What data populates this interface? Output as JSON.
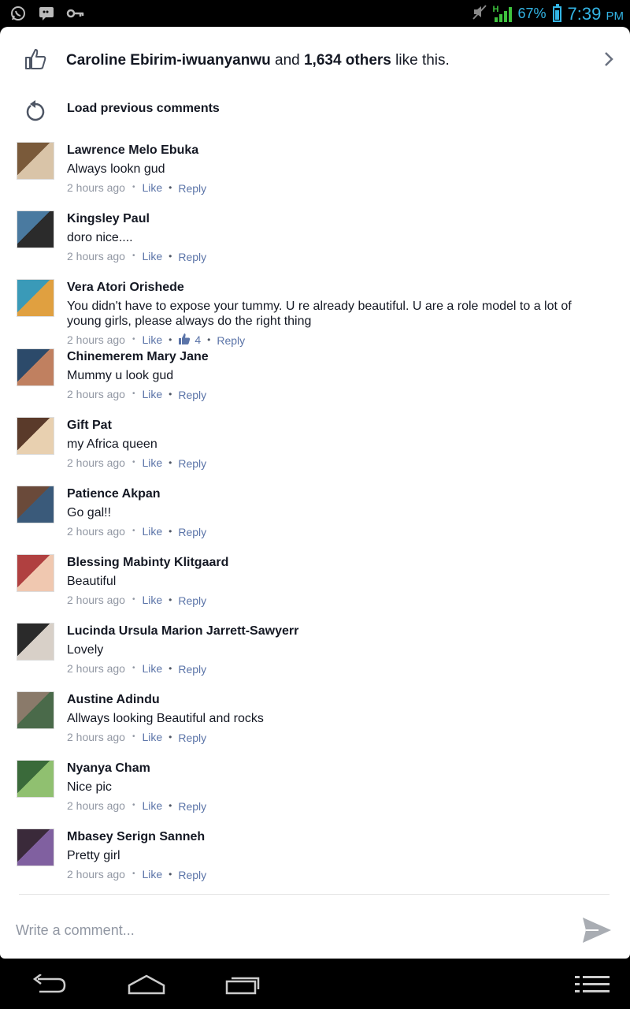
{
  "status_bar": {
    "battery_pct": "67%",
    "time": "7:39",
    "ampm": "PM",
    "network": "H",
    "icons": [
      "whatsapp-icon",
      "bbm-icon",
      "key-icon",
      "mute-icon",
      "signal-icon",
      "battery-icon"
    ]
  },
  "likes": {
    "first_liker": "Caroline Ebirim-iwuanyanwu",
    "connector": "and",
    "others": "1,634 others",
    "suffix": "like this."
  },
  "load_previous": "Load previous comments",
  "comments": [
    {
      "author": "Lawrence Melo Ebuka",
      "text": "Always lookn gud",
      "time": "2 hours ago",
      "like": "Like",
      "reply": "Reply"
    },
    {
      "author": "Kingsley Paul",
      "text": "doro nice....",
      "time": "2 hours ago",
      "like": "Like",
      "reply": "Reply"
    },
    {
      "author": "Vera Atori Orishede",
      "text": "You didn't have to expose your tummy. U re already beautiful. U are a role model to a lot of young girls, please always do the right thing",
      "time": "2 hours ago",
      "like": "Like",
      "like_count": "4",
      "reply": "Reply"
    },
    {
      "author": "Chinemerem Mary Jane",
      "text": "Mummy u look gud",
      "time": "2 hours ago",
      "like": "Like",
      "reply": "Reply"
    },
    {
      "author": "Gift Pat",
      "text": "my Africa queen",
      "time": "2 hours ago",
      "like": "Like",
      "reply": "Reply"
    },
    {
      "author": "Patience Akpan",
      "text": "Go gal!!",
      "time": "2 hours ago",
      "like": "Like",
      "reply": "Reply"
    },
    {
      "author": "Blessing Mabinty Klitgaard",
      "text": "Beautiful",
      "time": "2 hours ago",
      "like": "Like",
      "reply": "Reply"
    },
    {
      "author": "Lucinda Ursula Marion Jarrett-Sawyerr",
      "text": "Lovely",
      "time": "2 hours ago",
      "like": "Like",
      "reply": "Reply"
    },
    {
      "author": "Austine Adindu",
      "text": "Allways looking Beautiful and rocks",
      "time": "2 hours ago",
      "like": "Like",
      "reply": "Reply"
    },
    {
      "author": "Nyanya Cham",
      "text": "Nice pic",
      "time": "2 hours ago",
      "like": "Like",
      "reply": "Reply"
    },
    {
      "author": "Mbasey Serign Sanneh",
      "text": "Pretty girl",
      "time": "2 hours ago",
      "like": "Like",
      "reply": "Reply"
    }
  ],
  "comment_box": {
    "placeholder": "Write a comment..."
  },
  "colors": {
    "link": "#5b74a8",
    "text": "#141823",
    "meta": "#9197a3",
    "status": "#33b5e5"
  }
}
